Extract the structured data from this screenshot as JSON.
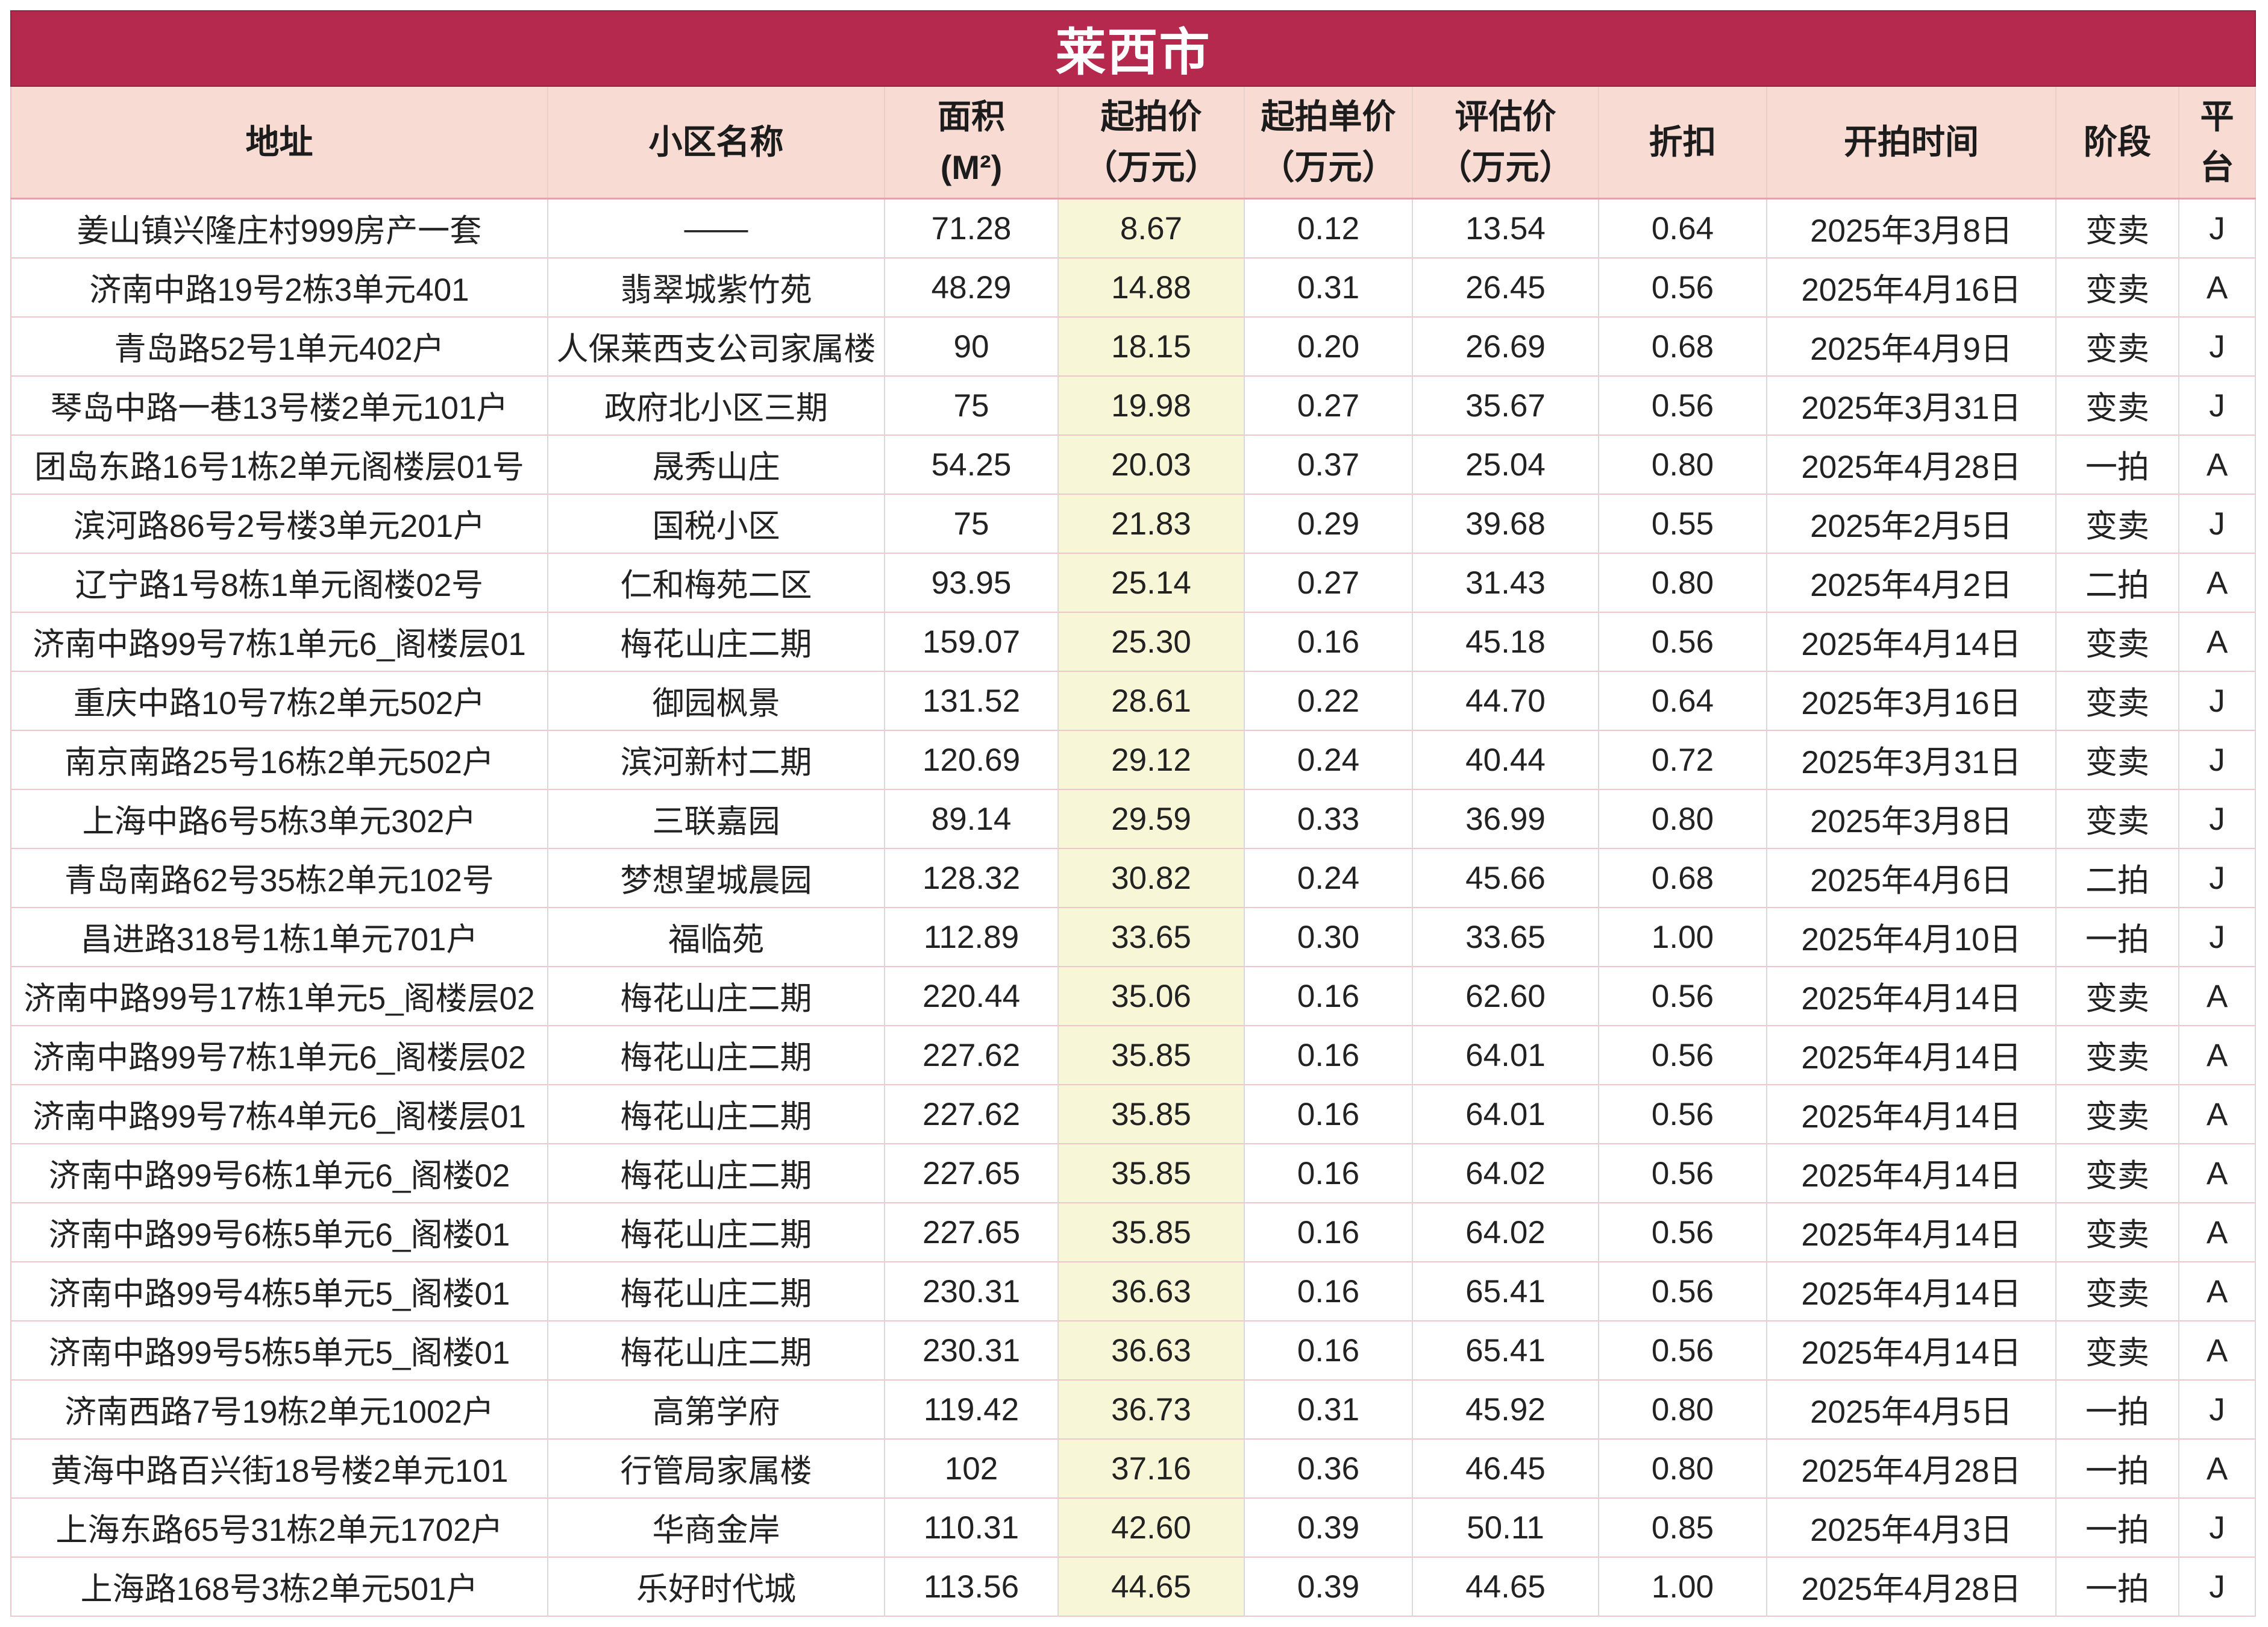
{
  "title": "莱西市",
  "colors": {
    "title_bar": "#b5294e",
    "title_text": "#ffffff",
    "header_bg": "#f8dcd4",
    "highlight_column": "#f7f7d7"
  },
  "header": [
    {
      "label": "地址"
    },
    {
      "label": "小区名称"
    },
    {
      "label": "面积",
      "unit": "(M²)"
    },
    {
      "label": "起拍价",
      "unit": "（万元）"
    },
    {
      "label": "起拍单价",
      "unit": "（万元）"
    },
    {
      "label": "评估价",
      "unit": "（万元）"
    },
    {
      "label": "折扣"
    },
    {
      "label": "开拍时间"
    },
    {
      "label": "阶段"
    },
    {
      "label": "平台"
    }
  ],
  "rows": [
    [
      "姜山镇兴隆庄村999房产一套",
      "——",
      "71.28",
      "8.67",
      "0.12",
      "13.54",
      "0.64",
      "2025年3月8日",
      "变卖",
      "J"
    ],
    [
      "济南中路19号2栋3单元401",
      "翡翠城紫竹苑",
      "48.29",
      "14.88",
      "0.31",
      "26.45",
      "0.56",
      "2025年4月16日",
      "变卖",
      "A"
    ],
    [
      "青岛路52号1单元402户",
      "人保莱西支公司家属楼",
      "90",
      "18.15",
      "0.20",
      "26.69",
      "0.68",
      "2025年4月9日",
      "变卖",
      "J"
    ],
    [
      "琴岛中路一巷13号楼2单元101户",
      "政府北小区三期",
      "75",
      "19.98",
      "0.27",
      "35.67",
      "0.56",
      "2025年3月31日",
      "变卖",
      "J"
    ],
    [
      "团岛东路16号1栋2单元阁楼层01号",
      "晟秀山庄",
      "54.25",
      "20.03",
      "0.37",
      "25.04",
      "0.80",
      "2025年4月28日",
      "一拍",
      "A"
    ],
    [
      "滨河路86号2号楼3单元201户",
      "国税小区",
      "75",
      "21.83",
      "0.29",
      "39.68",
      "0.55",
      "2025年2月5日",
      "变卖",
      "J"
    ],
    [
      "辽宁路1号8栋1单元阁楼02号",
      "仁和梅苑二区",
      "93.95",
      "25.14",
      "0.27",
      "31.43",
      "0.80",
      "2025年4月2日",
      "二拍",
      "A"
    ],
    [
      "济南中路99号7栋1单元6_阁楼层01",
      "梅花山庄二期",
      "159.07",
      "25.30",
      "0.16",
      "45.18",
      "0.56",
      "2025年4月14日",
      "变卖",
      "A"
    ],
    [
      "重庆中路10号7栋2单元502户",
      "御园枫景",
      "131.52",
      "28.61",
      "0.22",
      "44.70",
      "0.64",
      "2025年3月16日",
      "变卖",
      "J"
    ],
    [
      "南京南路25号16栋2单元502户",
      "滨河新村二期",
      "120.69",
      "29.12",
      "0.24",
      "40.44",
      "0.72",
      "2025年3月31日",
      "变卖",
      "J"
    ],
    [
      "上海中路6号5栋3单元302户",
      "三联嘉园",
      "89.14",
      "29.59",
      "0.33",
      "36.99",
      "0.80",
      "2025年3月8日",
      "变卖",
      "J"
    ],
    [
      "青岛南路62号35栋2单元102号",
      "梦想望城晨园",
      "128.32",
      "30.82",
      "0.24",
      "45.66",
      "0.68",
      "2025年4月6日",
      "二拍",
      "J"
    ],
    [
      "昌进路318号1栋1单元701户",
      "福临苑",
      "112.89",
      "33.65",
      "0.30",
      "33.65",
      "1.00",
      "2025年4月10日",
      "一拍",
      "J"
    ],
    [
      "济南中路99号17栋1单元5_阁楼层02",
      "梅花山庄二期",
      "220.44",
      "35.06",
      "0.16",
      "62.60",
      "0.56",
      "2025年4月14日",
      "变卖",
      "A"
    ],
    [
      "济南中路99号7栋1单元6_阁楼层02",
      "梅花山庄二期",
      "227.62",
      "35.85",
      "0.16",
      "64.01",
      "0.56",
      "2025年4月14日",
      "变卖",
      "A"
    ],
    [
      "济南中路99号7栋4单元6_阁楼层01",
      "梅花山庄二期",
      "227.62",
      "35.85",
      "0.16",
      "64.01",
      "0.56",
      "2025年4月14日",
      "变卖",
      "A"
    ],
    [
      "济南中路99号6栋1单元6_阁楼02",
      "梅花山庄二期",
      "227.65",
      "35.85",
      "0.16",
      "64.02",
      "0.56",
      "2025年4月14日",
      "变卖",
      "A"
    ],
    [
      "济南中路99号6栋5单元6_阁楼01",
      "梅花山庄二期",
      "227.65",
      "35.85",
      "0.16",
      "64.02",
      "0.56",
      "2025年4月14日",
      "变卖",
      "A"
    ],
    [
      "济南中路99号4栋5单元5_阁楼01",
      "梅花山庄二期",
      "230.31",
      "36.63",
      "0.16",
      "65.41",
      "0.56",
      "2025年4月14日",
      "变卖",
      "A"
    ],
    [
      "济南中路99号5栋5单元5_阁楼01",
      "梅花山庄二期",
      "230.31",
      "36.63",
      "0.16",
      "65.41",
      "0.56",
      "2025年4月14日",
      "变卖",
      "A"
    ],
    [
      "济南西路7号19栋2单元1002户",
      "高第学府",
      "119.42",
      "36.73",
      "0.31",
      "45.92",
      "0.80",
      "2025年4月5日",
      "一拍",
      "J"
    ],
    [
      "黄海中路百兴街18号楼2单元101",
      "行管局家属楼",
      "102",
      "37.16",
      "0.36",
      "46.45",
      "0.80",
      "2025年4月28日",
      "一拍",
      "A"
    ],
    [
      "上海东路65号31栋2单元1702户",
      "华商金岸",
      "110.31",
      "42.60",
      "0.39",
      "50.11",
      "0.85",
      "2025年4月3日",
      "一拍",
      "J"
    ],
    [
      "上海路168号3栋2单元501户",
      "乐好时代城",
      "113.56",
      "44.65",
      "0.39",
      "44.65",
      "1.00",
      "2025年4月28日",
      "一拍",
      "J"
    ]
  ]
}
